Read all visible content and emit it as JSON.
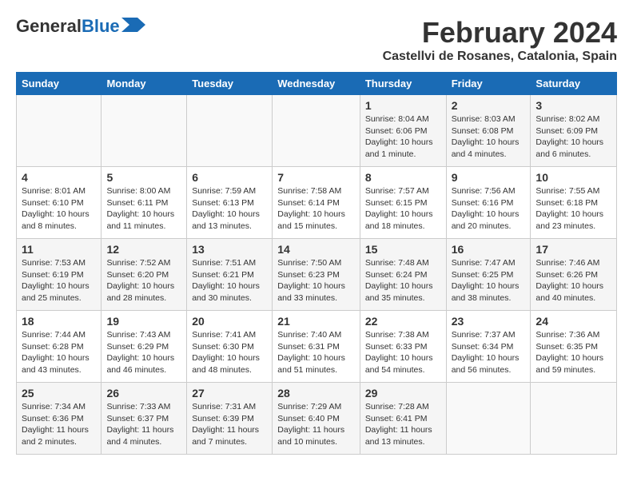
{
  "header": {
    "logo_general": "General",
    "logo_blue": "Blue",
    "month_year": "February 2024",
    "location": "Castellvi de Rosanes, Catalonia, Spain"
  },
  "calendar": {
    "weekdays": [
      "Sunday",
      "Monday",
      "Tuesday",
      "Wednesday",
      "Thursday",
      "Friday",
      "Saturday"
    ],
    "weeks": [
      [
        {
          "day": "",
          "info": ""
        },
        {
          "day": "",
          "info": ""
        },
        {
          "day": "",
          "info": ""
        },
        {
          "day": "",
          "info": ""
        },
        {
          "day": "1",
          "info": "Sunrise: 8:04 AM\nSunset: 6:06 PM\nDaylight: 10 hours\nand 1 minute."
        },
        {
          "day": "2",
          "info": "Sunrise: 8:03 AM\nSunset: 6:08 PM\nDaylight: 10 hours\nand 4 minutes."
        },
        {
          "day": "3",
          "info": "Sunrise: 8:02 AM\nSunset: 6:09 PM\nDaylight: 10 hours\nand 6 minutes."
        }
      ],
      [
        {
          "day": "4",
          "info": "Sunrise: 8:01 AM\nSunset: 6:10 PM\nDaylight: 10 hours\nand 8 minutes."
        },
        {
          "day": "5",
          "info": "Sunrise: 8:00 AM\nSunset: 6:11 PM\nDaylight: 10 hours\nand 11 minutes."
        },
        {
          "day": "6",
          "info": "Sunrise: 7:59 AM\nSunset: 6:13 PM\nDaylight: 10 hours\nand 13 minutes."
        },
        {
          "day": "7",
          "info": "Sunrise: 7:58 AM\nSunset: 6:14 PM\nDaylight: 10 hours\nand 15 minutes."
        },
        {
          "day": "8",
          "info": "Sunrise: 7:57 AM\nSunset: 6:15 PM\nDaylight: 10 hours\nand 18 minutes."
        },
        {
          "day": "9",
          "info": "Sunrise: 7:56 AM\nSunset: 6:16 PM\nDaylight: 10 hours\nand 20 minutes."
        },
        {
          "day": "10",
          "info": "Sunrise: 7:55 AM\nSunset: 6:18 PM\nDaylight: 10 hours\nand 23 minutes."
        }
      ],
      [
        {
          "day": "11",
          "info": "Sunrise: 7:53 AM\nSunset: 6:19 PM\nDaylight: 10 hours\nand 25 minutes."
        },
        {
          "day": "12",
          "info": "Sunrise: 7:52 AM\nSunset: 6:20 PM\nDaylight: 10 hours\nand 28 minutes."
        },
        {
          "day": "13",
          "info": "Sunrise: 7:51 AM\nSunset: 6:21 PM\nDaylight: 10 hours\nand 30 minutes."
        },
        {
          "day": "14",
          "info": "Sunrise: 7:50 AM\nSunset: 6:23 PM\nDaylight: 10 hours\nand 33 minutes."
        },
        {
          "day": "15",
          "info": "Sunrise: 7:48 AM\nSunset: 6:24 PM\nDaylight: 10 hours\nand 35 minutes."
        },
        {
          "day": "16",
          "info": "Sunrise: 7:47 AM\nSunset: 6:25 PM\nDaylight: 10 hours\nand 38 minutes."
        },
        {
          "day": "17",
          "info": "Sunrise: 7:46 AM\nSunset: 6:26 PM\nDaylight: 10 hours\nand 40 minutes."
        }
      ],
      [
        {
          "day": "18",
          "info": "Sunrise: 7:44 AM\nSunset: 6:28 PM\nDaylight: 10 hours\nand 43 minutes."
        },
        {
          "day": "19",
          "info": "Sunrise: 7:43 AM\nSunset: 6:29 PM\nDaylight: 10 hours\nand 46 minutes."
        },
        {
          "day": "20",
          "info": "Sunrise: 7:41 AM\nSunset: 6:30 PM\nDaylight: 10 hours\nand 48 minutes."
        },
        {
          "day": "21",
          "info": "Sunrise: 7:40 AM\nSunset: 6:31 PM\nDaylight: 10 hours\nand 51 minutes."
        },
        {
          "day": "22",
          "info": "Sunrise: 7:38 AM\nSunset: 6:33 PM\nDaylight: 10 hours\nand 54 minutes."
        },
        {
          "day": "23",
          "info": "Sunrise: 7:37 AM\nSunset: 6:34 PM\nDaylight: 10 hours\nand 56 minutes."
        },
        {
          "day": "24",
          "info": "Sunrise: 7:36 AM\nSunset: 6:35 PM\nDaylight: 10 hours\nand 59 minutes."
        }
      ],
      [
        {
          "day": "25",
          "info": "Sunrise: 7:34 AM\nSunset: 6:36 PM\nDaylight: 11 hours\nand 2 minutes."
        },
        {
          "day": "26",
          "info": "Sunrise: 7:33 AM\nSunset: 6:37 PM\nDaylight: 11 hours\nand 4 minutes."
        },
        {
          "day": "27",
          "info": "Sunrise: 7:31 AM\nSunset: 6:39 PM\nDaylight: 11 hours\nand 7 minutes."
        },
        {
          "day": "28",
          "info": "Sunrise: 7:29 AM\nSunset: 6:40 PM\nDaylight: 11 hours\nand 10 minutes."
        },
        {
          "day": "29",
          "info": "Sunrise: 7:28 AM\nSunset: 6:41 PM\nDaylight: 11 hours\nand 13 minutes."
        },
        {
          "day": "",
          "info": ""
        },
        {
          "day": "",
          "info": ""
        }
      ]
    ]
  }
}
